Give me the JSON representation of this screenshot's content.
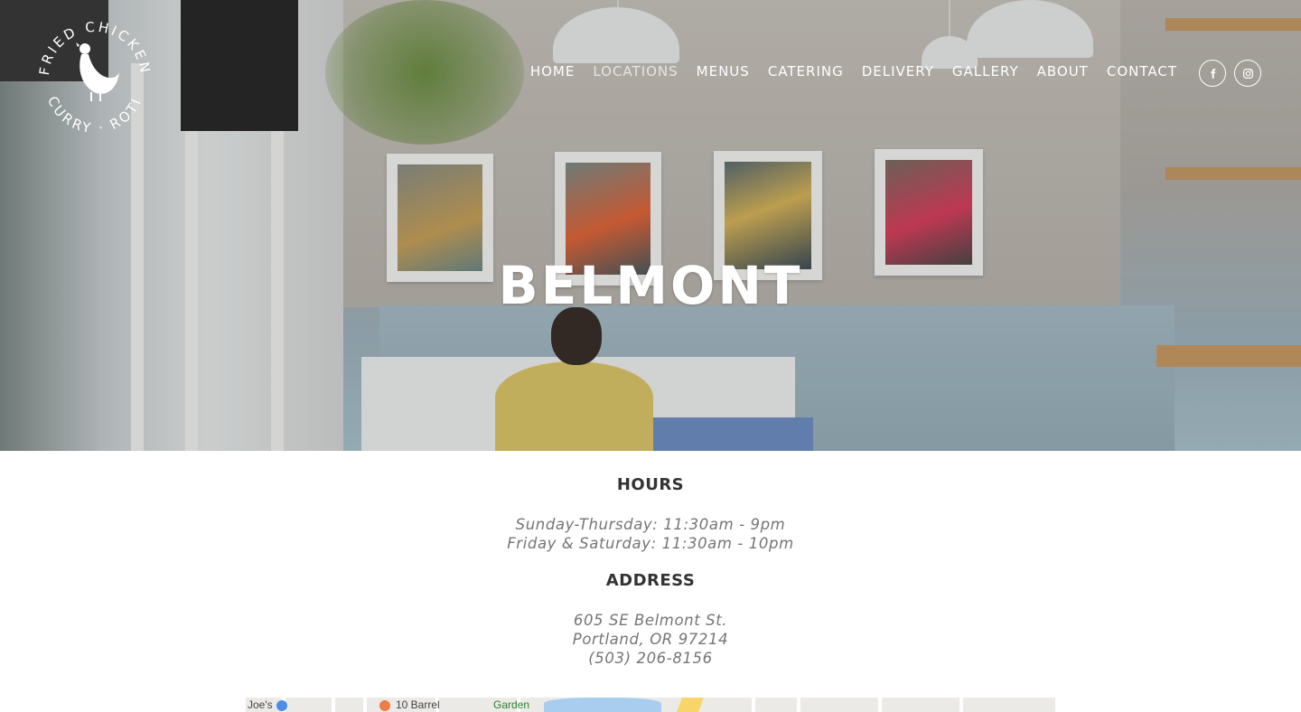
{
  "brand": {
    "logo_top_text": "FRIED CHICKEN",
    "logo_bottom_text": "CURRY · ROTI"
  },
  "nav": {
    "items": [
      {
        "label": "HOME",
        "active": false
      },
      {
        "label": "LOCATIONS",
        "active": true
      },
      {
        "label": "MENUS",
        "active": false
      },
      {
        "label": "CATERING",
        "active": false
      },
      {
        "label": "DELIVERY",
        "active": false
      },
      {
        "label": "GALLERY",
        "active": false
      },
      {
        "label": "ABOUT",
        "active": false
      },
      {
        "label": "CONTACT",
        "active": false
      }
    ],
    "social": [
      {
        "icon": "facebook-icon"
      },
      {
        "icon": "instagram-icon"
      }
    ]
  },
  "hero": {
    "title": "BELMONT"
  },
  "hours": {
    "heading": "HOURS",
    "lines": [
      "Sunday-Thursday: 11:30am - 9pm",
      "Friday & Saturday: 11:30am - 10pm"
    ]
  },
  "address": {
    "heading": "ADDRESS",
    "street": "605 SE Belmont St.",
    "city": "Portland, OR 97214",
    "phone": "(503) 206-8156"
  },
  "map": {
    "labels": [
      "Joe's",
      "10 Barrel",
      "Garden"
    ]
  },
  "colors": {
    "nav_text": "#ffffff",
    "heading_text": "#333333",
    "italic_text": "#757575",
    "background": "#ffffff"
  }
}
